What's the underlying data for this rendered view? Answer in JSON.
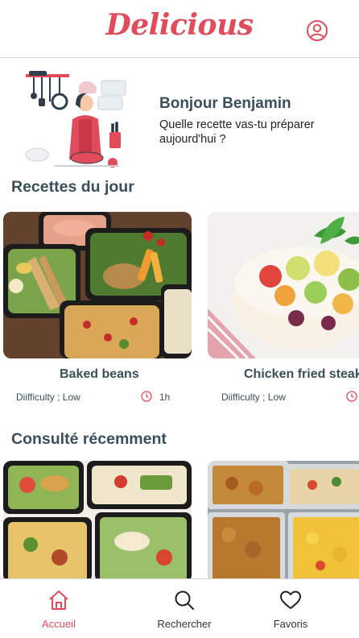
{
  "app": {
    "logo_text": "Delicious"
  },
  "header": {
    "profile_icon": "user-circle-icon"
  },
  "hero": {
    "greeting": "Bonjour Benjamin",
    "question": "Quelle recette vas-tu préparer aujourd'hui ?"
  },
  "sections": {
    "daily_title": "Recettes du jour",
    "recent_title": "Consulté récemment"
  },
  "daily_recipes": [
    {
      "name": "Baked beans",
      "difficulty": "Diifficulty ; Low",
      "time": "1h"
    },
    {
      "name": "Chicken fried steak",
      "difficulty": "Diifficulty ; Low",
      "time": ""
    }
  ],
  "nav": {
    "items": [
      {
        "label": "Accueil",
        "icon": "home-icon",
        "active": true
      },
      {
        "label": "Rechercher",
        "icon": "search-icon",
        "active": false
      },
      {
        "label": "Favoris",
        "icon": "heart-icon",
        "active": false
      }
    ]
  },
  "colors": {
    "accent": "#e14b5a",
    "heading": "#3a4f5c"
  }
}
